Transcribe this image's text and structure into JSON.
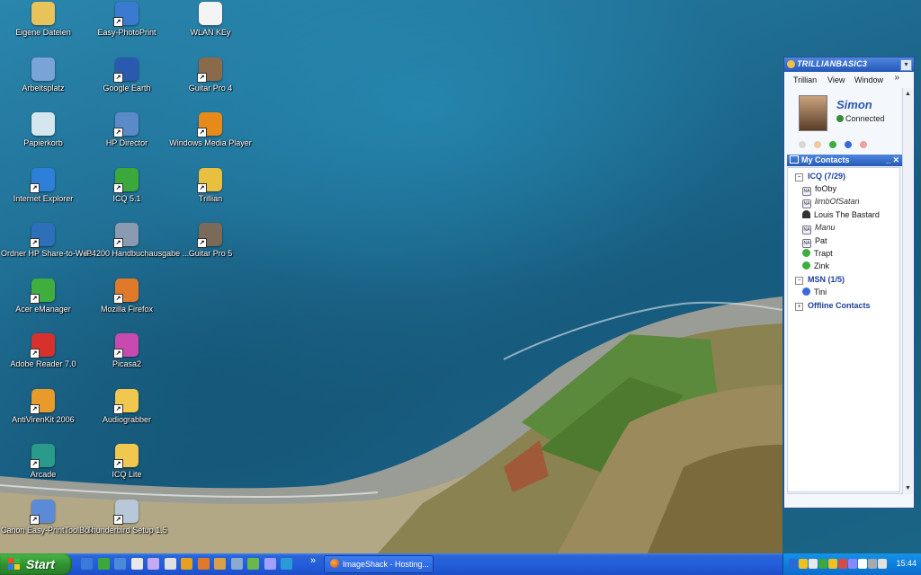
{
  "desktop_icons": [
    {
      "label": "Eigene Dateien",
      "icon": "folder-documents-icon",
      "color": "#e8c35a"
    },
    {
      "label": "Arbeitsplatz",
      "icon": "computer-icon",
      "color": "#7aa4d8"
    },
    {
      "label": "Papierkorb",
      "icon": "recycle-bin-icon",
      "color": "#d6e6ee"
    },
    {
      "label": "Internet Explorer",
      "icon": "internet-explorer-icon",
      "color": "#2d7fd8"
    },
    {
      "label": "Ordner HP Share-to-Web",
      "icon": "hp-folder-icon",
      "color": "#2d6fb8"
    },
    {
      "label": "Acer eManager",
      "icon": "acer-emanager-icon",
      "color": "#3fae3f"
    },
    {
      "label": "Adobe Reader 7.0",
      "icon": "adobe-reader-icon",
      "color": "#d8302a"
    },
    {
      "label": "AntiVirenKit 2006",
      "icon": "antivirus-icon",
      "color": "#e89a2a"
    },
    {
      "label": "Arcade",
      "icon": "arcade-icon",
      "color": "#2a9a8a"
    },
    {
      "label": "Canon Easy-PrintToolBox",
      "icon": "canon-printer-icon",
      "color": "#5a8ad8"
    },
    {
      "label": "Easy-PhotoPrint",
      "icon": "photoprint-icon",
      "color": "#3a7ad0"
    },
    {
      "label": "Google Earth",
      "icon": "google-earth-icon",
      "color": "#2a5ab0"
    },
    {
      "label": "HP Director",
      "icon": "hp-director-icon",
      "color": "#5a8ac8"
    },
    {
      "label": "ICQ 5.1",
      "icon": "icq-icon",
      "color": "#3aa83a"
    },
    {
      "label": "iP4200 Handbuchausgabe ...",
      "icon": "canon-manual-icon",
      "color": "#8a9ab0"
    },
    {
      "label": "Mozilla Firefox",
      "icon": "firefox-icon",
      "color": "#e07a2a"
    },
    {
      "label": "Picasa2",
      "icon": "picasa-icon",
      "color": "#c84ab0"
    },
    {
      "label": "Audiograbber",
      "icon": "folder-icon",
      "color": "#f0c850"
    },
    {
      "label": "ICQ Lite",
      "icon": "folder-icon",
      "color": "#f0c850"
    },
    {
      "label": "Thunderbird Setup 1.5",
      "icon": "cd-setup-icon",
      "color": "#b8c8d8"
    },
    {
      "label": "WLAN KEy",
      "icon": "text-document-icon",
      "color": "#f4f4f4"
    },
    {
      "label": "Guitar Pro 4",
      "icon": "guitar-pro-icon",
      "color": "#8a6a4a"
    },
    {
      "label": "Windows Media Player",
      "icon": "media-player-icon",
      "color": "#e88a1a"
    },
    {
      "label": "Trillian",
      "icon": "trillian-icon",
      "color": "#e8c040"
    },
    {
      "label": "Guitar Pro 5",
      "icon": "guitar-pro-icon",
      "color": "#7a6a5a"
    }
  ],
  "trillian": {
    "brand": "TRILLIANBASIC3",
    "menu": [
      "Trillian",
      "View",
      "Window"
    ],
    "menu_more": "»",
    "user_name": "Simon",
    "user_status": "Connected",
    "contacts_title": "My Contacts",
    "contacts_buttons": "_ ✕",
    "groups": [
      {
        "label": "ICQ (7/29)",
        "expander": "−"
      },
      {
        "label": "MSN (1/5)",
        "expander": "−"
      },
      {
        "label": "Offline Contacts",
        "expander": "+"
      }
    ],
    "icq_contacts": [
      {
        "name": "foOby",
        "status": "na"
      },
      {
        "name": "limbOfSatan",
        "status": "na-italic"
      },
      {
        "name": "Louis The Bastard",
        "status": "flower"
      },
      {
        "name": "Manu",
        "status": "na-italic"
      },
      {
        "name": "Pat",
        "status": "na"
      },
      {
        "name": "Trapt",
        "status": "online"
      },
      {
        "name": "Zink",
        "status": "online"
      }
    ],
    "msn_contacts": [
      {
        "name": "Tini",
        "status": "msn"
      }
    ],
    "status_dots": [
      "#d8d8d8",
      "#f0c8a0",
      "#3cae3c",
      "#3a6ad8",
      "#f0a0a0"
    ]
  },
  "taskbar": {
    "start_label": "Start",
    "quicklaunch_more": "»",
    "active_task": "ImageShack - Hosting...",
    "clock": "15:44",
    "quicklaunch_colors": [
      "#3a7ad8",
      "#3aa83a",
      "#4a8ad8",
      "#e8e8e8",
      "#c8a8f8",
      "#e0e0e0",
      "#e8a020",
      "#e07a2a",
      "#d8a048",
      "#8aaad0",
      "#6ab84a",
      "#a0a0ff",
      "#2a9ad8"
    ],
    "tray_colors": [
      "#2a6ad8",
      "#f0c020",
      "#e8e8e8",
      "#3aa83a",
      "#f0c020",
      "#d84a4a",
      "#8888ff",
      "#ffffff",
      "#aaaaaa",
      "#e0e0e0"
    ]
  }
}
